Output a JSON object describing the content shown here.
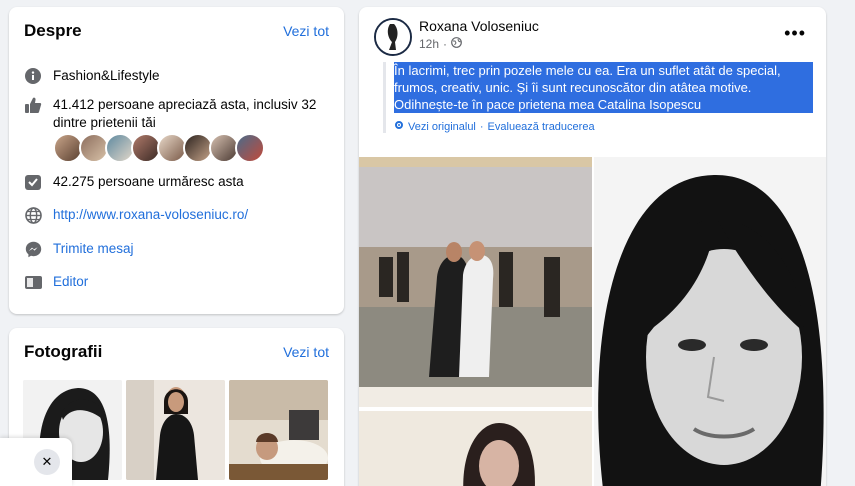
{
  "about": {
    "title": "Despre",
    "see_all": "Vezi tot",
    "category": "Fashion&Lifestyle",
    "likes": "41.412 persoane apreciază asta, inclusiv 32 dintre prietenii tăi",
    "followers": "42.275 persoane urmăresc asta",
    "website": "http://www.roxana-voloseniuc.ro/",
    "message": "Trimite mesaj",
    "editor": "Editor"
  },
  "photos": {
    "title": "Fotografii",
    "see_all": "Vezi tot"
  },
  "toast": {
    "close_glyph": "✕"
  },
  "post": {
    "author": "Roxana Voloseniuc",
    "time": "12h",
    "more_glyph": "•••",
    "text": "În lacrimi, trec prin pozele mele cu ea. Era un suflet atât de special, frumos, creativ, unic. Și îi sunt recunoscător din atâtea motive. Odihnește-te în pace prietena mea Catalina Isopescu",
    "see_original": "Vezi originalul",
    "separator": "·",
    "rate_translation": "Evaluează traducerea"
  },
  "colors": {
    "link": "#216fdb",
    "selection": "#2f6ee0",
    "background": "#f0f2f5"
  }
}
